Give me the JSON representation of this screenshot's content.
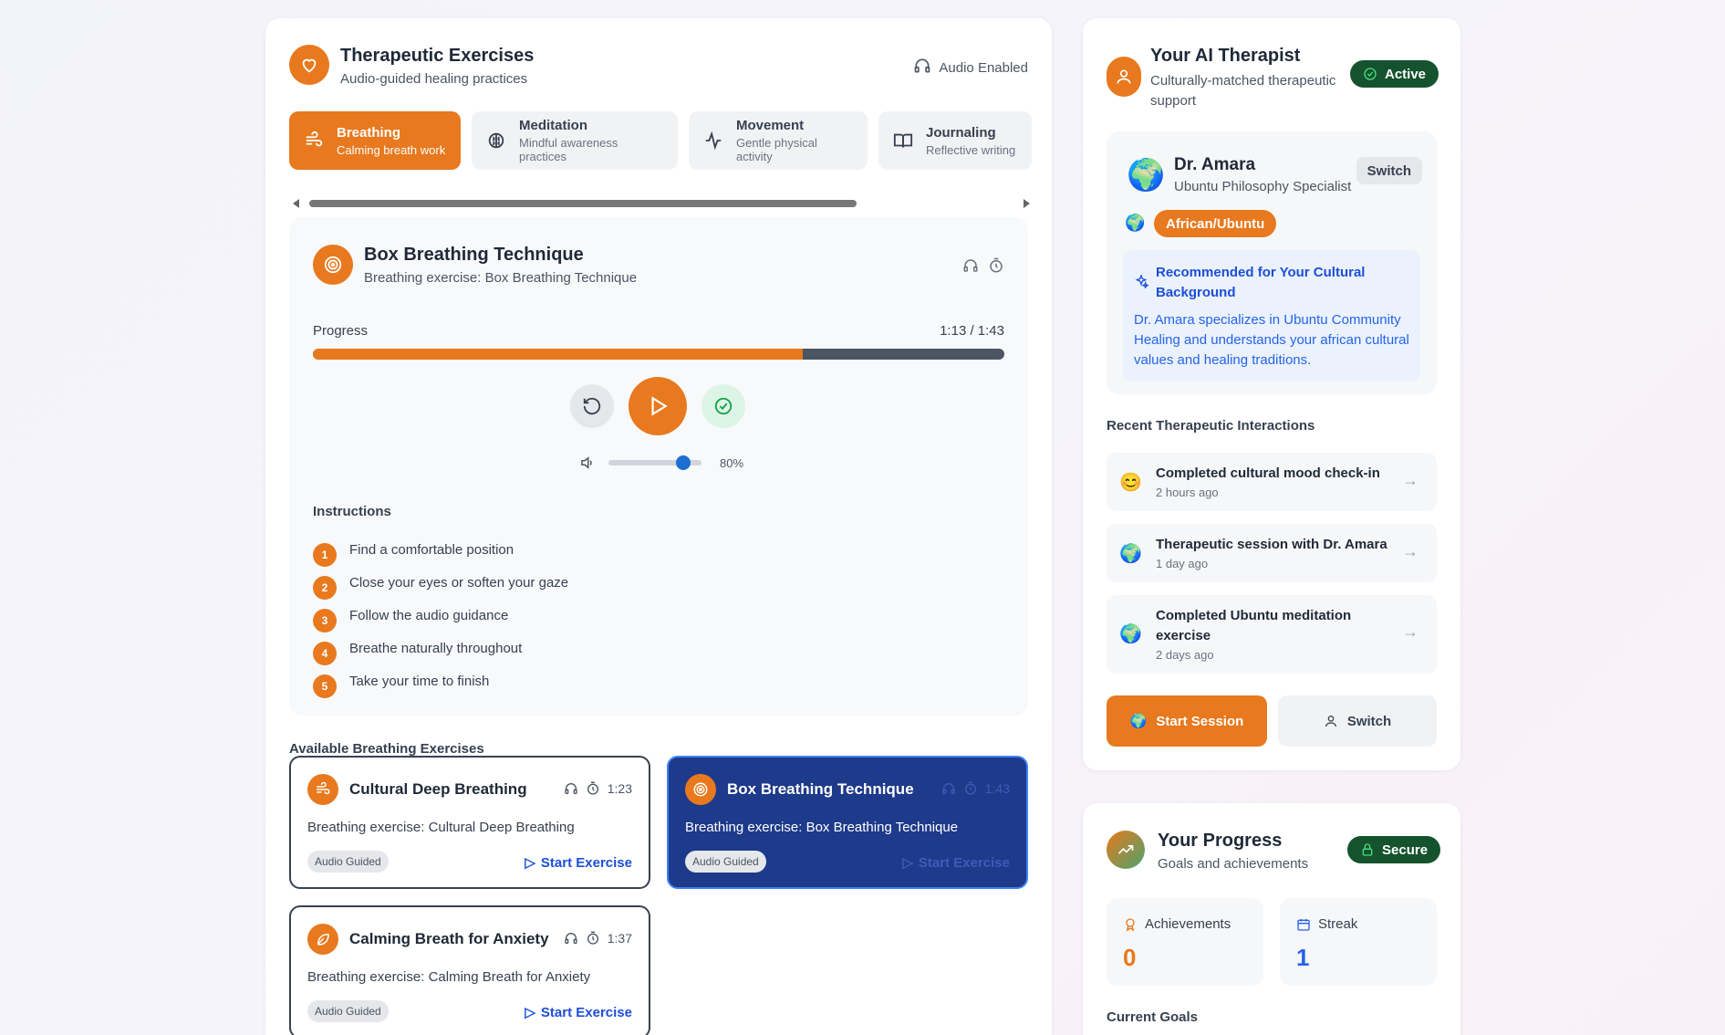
{
  "exercises_panel": {
    "title": "Therapeutic Exercises",
    "subtitle": "Audio-guided healing practices",
    "audio_status": "Audio Enabled",
    "tabs": [
      {
        "label": "Breathing",
        "sub": "Calming breath work",
        "icon": "wind-icon"
      },
      {
        "label": "Meditation",
        "sub": "Mindful awareness practices",
        "icon": "brain-icon"
      },
      {
        "label": "Movement",
        "sub": "Gentle physical activity",
        "icon": "activity-icon"
      },
      {
        "label": "Journaling",
        "sub": "Reflective writing",
        "icon": "book-icon"
      }
    ]
  },
  "player": {
    "title": "Box Breathing Technique",
    "subtitle": "Breathing exercise: Box Breathing Technique",
    "progress_label": "Progress",
    "time": "1:13 / 1:43",
    "progress_fraction": 0.709,
    "volume_label": "80%",
    "volume_fraction": 0.8,
    "instructions_title": "Instructions",
    "instructions": [
      {
        "n": "1",
        "text": "Find a comfortable position"
      },
      {
        "n": "2",
        "text": "Close your eyes or soften your gaze"
      },
      {
        "n": "3",
        "text": "Follow the audio guidance"
      },
      {
        "n": "4",
        "text": "Breathe naturally throughout"
      },
      {
        "n": "5",
        "text": "Take your time to finish"
      }
    ]
  },
  "available": {
    "title": "Available Breathing Exercises",
    "cards": [
      {
        "title": "Cultural Deep Breathing",
        "duration": "1:23",
        "desc": "Breathing exercise: Cultural Deep Breathing",
        "chip": "Audio Guided",
        "action": "Start Exercise"
      },
      {
        "title": "Box Breathing Technique",
        "duration": "1:43",
        "desc": "Breathing exercise: Box Breathing Technique",
        "chip": "Audio Guided",
        "action": "Start Exercise"
      },
      {
        "title": "Calming Breath for Anxiety",
        "duration": "1:37",
        "desc": "Breathing exercise: Calming Breath for Anxiety",
        "chip": "Audio Guided",
        "action": "Start Exercise"
      }
    ]
  },
  "therapist": {
    "title": "Your AI Therapist",
    "subtitle": "Culturally-matched therapeutic support",
    "status": "Active",
    "name": "Dr. Amara",
    "specialty": "Ubuntu Philosophy Specialist",
    "switch_label": "Switch",
    "culture": "African/Ubuntu",
    "rec_title": "Recommended for Your Cultural Background",
    "rec_body": "Dr. Amara specializes in Ubuntu Community Healing and understands your african cultural values and healing traditions.",
    "recent_title": "Recent Therapeutic Interactions",
    "interactions": [
      {
        "emoji": "😊",
        "title": "Completed cultural mood check-in",
        "time": "2 hours ago"
      },
      {
        "emoji": "🌍",
        "title": "Therapeutic session with Dr. Amara",
        "time": "1 day ago"
      },
      {
        "emoji": "🌍",
        "title": "Completed Ubuntu meditation exercise",
        "time": "2 days ago"
      }
    ],
    "start_label": "Start Session",
    "switch_btn_label": "Switch"
  },
  "progress": {
    "title": "Your Progress",
    "subtitle": "Goals and achievements",
    "status": "Secure",
    "achievements_label": "Achievements",
    "achievements_value": "0",
    "streak_label": "Streak",
    "streak_value": "1",
    "goals_title": "Current Goals"
  },
  "colors": {
    "accent": "#e8791e",
    "selected_card": "#1e3a8a",
    "link": "#1d4ed8",
    "status_green": "#14532d"
  }
}
